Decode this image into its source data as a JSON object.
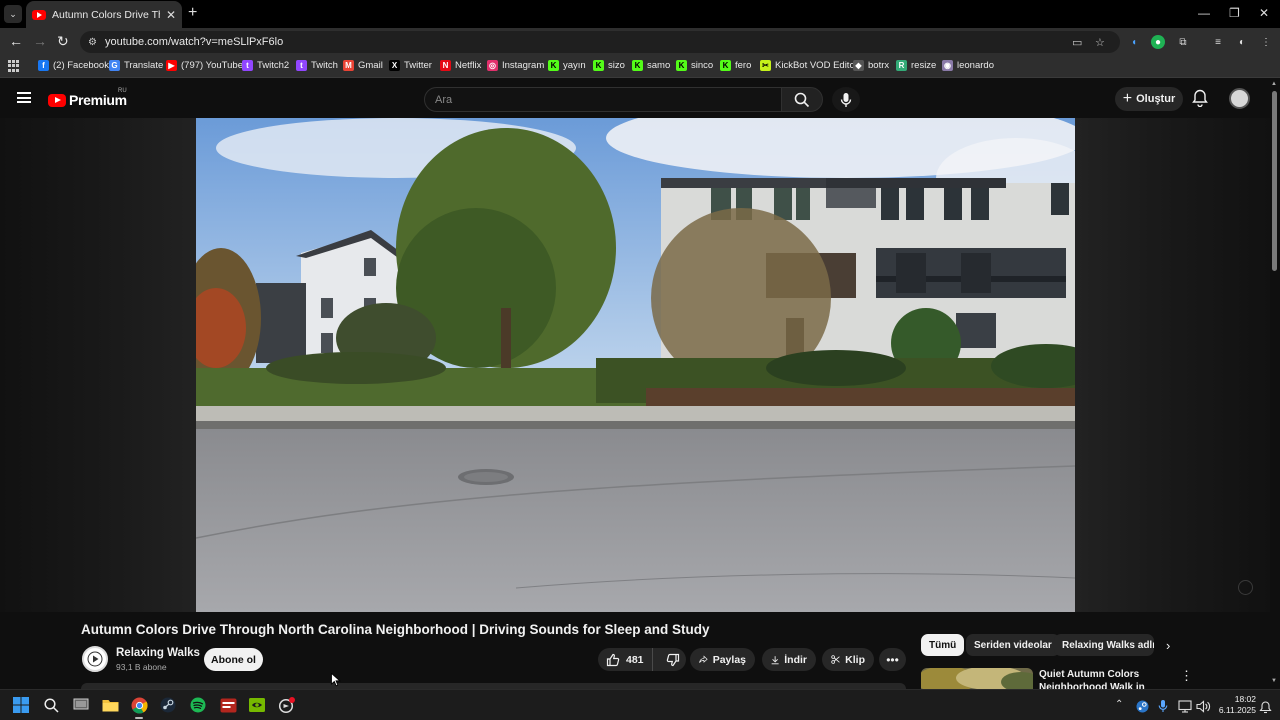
{
  "browser": {
    "tab": {
      "title": "Autumn Colors Drive Through N",
      "close": "✕"
    },
    "new_tab": "+",
    "window_controls": {
      "minimize": "—",
      "restore": "❐",
      "close": "✕"
    },
    "url": "youtube.com/watch?v=meSLlPxF6lo",
    "bookmarks": [
      {
        "label": "(2) Facebook",
        "icon": "facebook-icon",
        "color": "#1877f2",
        "glyph": "f"
      },
      {
        "label": "Translate",
        "icon": "translate-icon",
        "color": "#4285f4",
        "glyph": "G"
      },
      {
        "label": "(797) YouTube",
        "icon": "youtube-icon",
        "color": "#ff0000",
        "glyph": "▶"
      },
      {
        "label": "Twitch2",
        "icon": "twitch-icon",
        "color": "#9146ff",
        "glyph": "t"
      },
      {
        "label": "Twitch",
        "icon": "twitch-icon",
        "color": "#9146ff",
        "glyph": "t"
      },
      {
        "label": "Gmail",
        "icon": "gmail-icon",
        "color": "#ea4335",
        "glyph": "M"
      },
      {
        "label": "Twitter",
        "icon": "x-icon",
        "color": "#000000",
        "glyph": "X"
      },
      {
        "label": "Netflix",
        "icon": "netflix-icon",
        "color": "#e50914",
        "glyph": "N"
      },
      {
        "label": "Instagram",
        "icon": "instagram-icon",
        "color": "#e1306c",
        "glyph": "◎"
      },
      {
        "label": "yayın",
        "icon": "kick-icon",
        "color": "#53fc18",
        "glyph": "K"
      },
      {
        "label": "sizo",
        "icon": "kick-icon",
        "color": "#53fc18",
        "glyph": "K"
      },
      {
        "label": "samo",
        "icon": "kick-icon",
        "color": "#53fc18",
        "glyph": "K"
      },
      {
        "label": "sinco",
        "icon": "kick-icon",
        "color": "#53fc18",
        "glyph": "K"
      },
      {
        "label": "fero",
        "icon": "kick-icon",
        "color": "#53fc18",
        "glyph": "K"
      },
      {
        "label": "KickBot VOD Editor",
        "icon": "kickbot-icon",
        "color": "#c6f21a",
        "glyph": "✂"
      },
      {
        "label": "botrx",
        "icon": "botrx-icon",
        "color": "#555555",
        "glyph": "◆"
      },
      {
        "label": "resize",
        "icon": "resize-icon",
        "color": "#3a7",
        "glyph": "R"
      },
      {
        "label": "leonardo",
        "icon": "leonardo-icon",
        "color": "#8a7aa8",
        "glyph": "◉"
      }
    ]
  },
  "youtube": {
    "logo_text": "Premium",
    "region": "RU",
    "search_placeholder": "Ara",
    "create_label": "Oluştur",
    "video": {
      "title": "Autumn Colors Drive Through North Carolina Neighborhood | Driving Sounds for Sleep and Study",
      "channel": "Relaxing Walks",
      "subscribers": "93,1 B abone",
      "subscribe_label": "Abone ol",
      "likes": "481",
      "share_label": "Paylaş",
      "download_label": "İndir",
      "clip_label": "Klip",
      "more_label": "•••"
    },
    "chips": [
      "Tümü",
      "Seriden videolar",
      "Relaxing Walks adlı y"
    ],
    "recommendation": {
      "title": "Quiet Autumn Colors Neighborhood Walk in Light"
    }
  },
  "taskbar": {
    "clock_time": "18:02",
    "clock_date": "6.11.2025"
  },
  "colors": {
    "youtube_red": "#ff0000",
    "chrome_dark": "#2e2e2e",
    "page_bg": "#0f0f0f"
  }
}
